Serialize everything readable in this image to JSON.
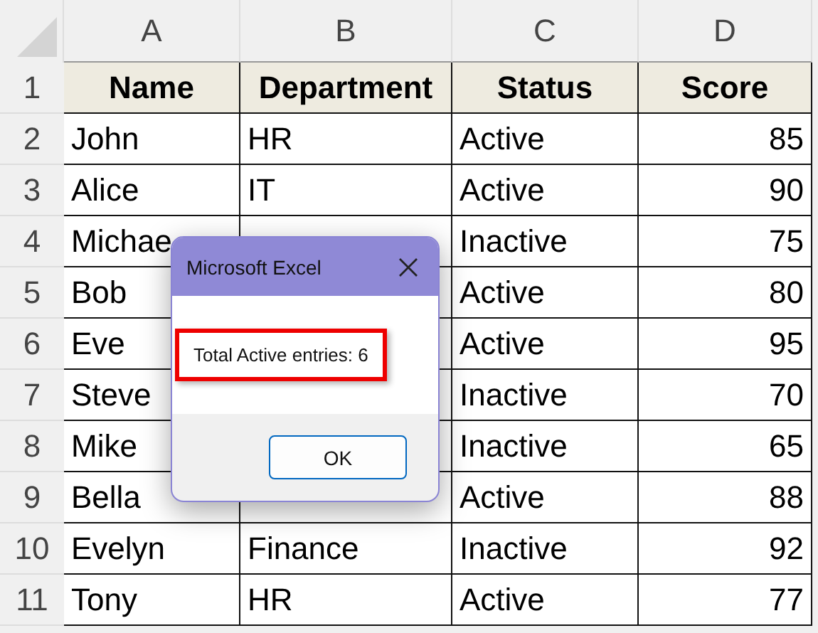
{
  "sheet": {
    "columns": [
      "A",
      "B",
      "C",
      "D"
    ],
    "header_row": {
      "num": "1",
      "cells": [
        "Name",
        "Department",
        "Status",
        "Score"
      ]
    },
    "rows": [
      {
        "num": "2",
        "name": "John",
        "department": "HR",
        "status": "Active",
        "score": "85"
      },
      {
        "num": "3",
        "name": "Alice",
        "department": "IT",
        "status": "Active",
        "score": "90"
      },
      {
        "num": "4",
        "name": "Michae",
        "status": "Inactive",
        "score": "75"
      },
      {
        "num": "5",
        "name": "Bob",
        "status": "Active",
        "score": "80"
      },
      {
        "num": "6",
        "name": "Eve",
        "status": "Active",
        "score": "95"
      },
      {
        "num": "7",
        "name": "Steve",
        "status": "Inactive",
        "score": "70"
      },
      {
        "num": "8",
        "name": "Mike",
        "status": "Inactive",
        "score": "65"
      },
      {
        "num": "9",
        "name": "Bella",
        "status": "Active",
        "score": "88"
      },
      {
        "num": "10",
        "name": "Evelyn",
        "department": "Finance",
        "status": "Inactive",
        "score": "92"
      },
      {
        "num": "11",
        "name": "Tony",
        "department": "HR",
        "status": "Active",
        "score": "77"
      }
    ]
  },
  "dialog": {
    "title": "Microsoft Excel",
    "message": "Total Active entries: 6",
    "highlighted": true,
    "buttons": [
      "OK"
    ]
  }
}
